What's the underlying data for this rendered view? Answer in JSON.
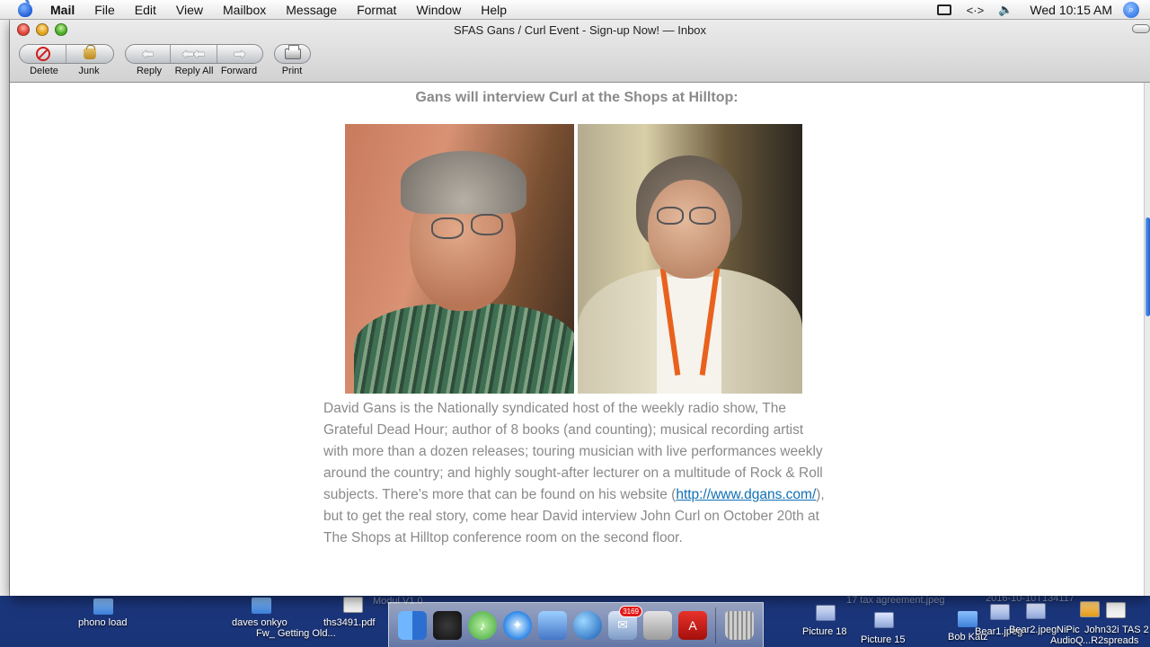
{
  "menubar": {
    "app": "Mail",
    "items": [
      "File",
      "Edit",
      "View",
      "Mailbox",
      "Message",
      "Format",
      "Window",
      "Help"
    ],
    "clock": "Wed 10:15 AM",
    "status_icons": [
      "display-icon",
      "sync-arrows-icon",
      "volume-icon",
      "spotlight-icon"
    ]
  },
  "window": {
    "title": "SFAS Gans / Curl Event - Sign-up Now! — Inbox",
    "toolbar": {
      "delete": "Delete",
      "junk": "Junk",
      "reply": "Reply",
      "reply_all": "Reply All",
      "forward": "Forward",
      "print": "Print"
    }
  },
  "message": {
    "heading": "Gans will interview Curl at the Shops at Hilltop:",
    "body_before_link": "David Gans is the Nationally syndicated host of the weekly radio show, The Grateful Dead Hour; author of 8 books (and counting); musical recording artist with more than a dozen releases; touring musician with live performances weekly around the country; and highly sought-after lecturer on a multitude of Rock & Roll subjects.  There’s more that can be found on his website (",
    "link": "http://www.dgans.com/",
    "body_after_link": "), but to get the real story, come hear David interview John Curl on October 20th at The Shops at Hilltop conference room on the second floor."
  },
  "desktop": {
    "labels": {
      "phono": "phono load",
      "daves": "daves onkyo",
      "fw": "Fw_ Getting Old...",
      "ths": "ths3491.pdf",
      "modul": "Modul V1.0",
      "picture18": "Picture 18",
      "picture15": "Picture 15",
      "tax": "17 tax agreement.jpeg",
      "date_file": "2016-10-10T134117",
      "bobkatz": "Bob Katz",
      "bear1": "Bear1.jpeg",
      "bear2": "Bear2.jpeg",
      "nipic": "NiPic",
      "john": "John32i",
      "tas2": "TAS 2",
      "audio": "AudioQ",
      "spreads": "...R2spreads"
    }
  },
  "dock": {
    "mail_badge": "3169"
  },
  "colors": {
    "accent_link": "#0f6fb5",
    "text_gray": "#8a8a8a",
    "desktop_blue": "#2d57b3"
  }
}
